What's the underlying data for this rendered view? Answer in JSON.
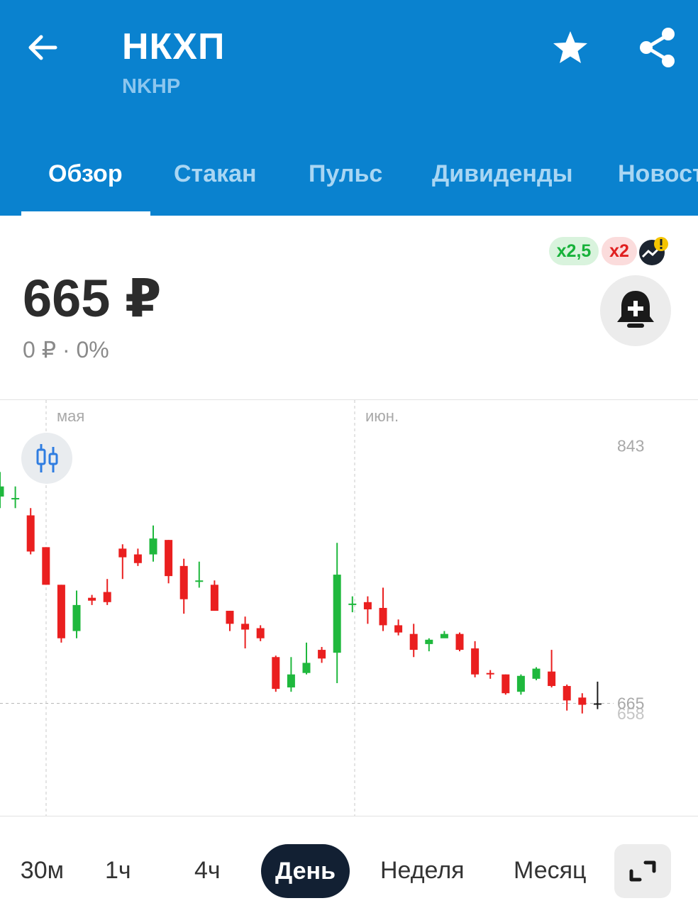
{
  "header": {
    "title": "НКХП",
    "ticker": "NKHP",
    "icons": {
      "back": "arrow-left-icon",
      "favorite": "star-icon",
      "share": "share-icon"
    }
  },
  "tabs": [
    {
      "label": "Обзор",
      "active": true
    },
    {
      "label": "Стакан"
    },
    {
      "label": "Пульс"
    },
    {
      "label": "Дивиденды"
    },
    {
      "label": "Новост"
    }
  ],
  "quote": {
    "price": "665 ₽",
    "change": "0 ₽ · 0%",
    "badge_long": "x2,5",
    "badge_short": "x2"
  },
  "colors": {
    "brand": "#0a82cf",
    "up": "#1fb83d",
    "down": "#ea1f1f",
    "active_pill": "#122033"
  },
  "chart_data": {
    "type": "candlestick",
    "x_labels": [
      "мая",
      "июн."
    ],
    "y_labels": [
      "843",
      "665",
      "658"
    ],
    "last_price": 665,
    "ylim": [
      600,
      860
    ],
    "candles": [
      {
        "o": 808,
        "h": 825,
        "c": 815,
        "l": 800
      },
      {
        "o": 807,
        "h": 815,
        "c": 807,
        "l": 800
      },
      {
        "o": 795,
        "h": 800,
        "c": 770,
        "l": 768
      },
      {
        "o": 773,
        "h": 773,
        "c": 747,
        "l": 747
      },
      {
        "o": 747,
        "h": 747,
        "c": 710,
        "l": 707
      },
      {
        "o": 715,
        "h": 743,
        "c": 733,
        "l": 710
      },
      {
        "o": 738,
        "h": 740,
        "c": 736,
        "l": 733
      },
      {
        "o": 742,
        "h": 751,
        "c": 735,
        "l": 733
      },
      {
        "o": 772,
        "h": 775,
        "c": 766,
        "l": 751
      },
      {
        "o": 768,
        "h": 772,
        "c": 762,
        "l": 760
      },
      {
        "o": 768,
        "h": 788,
        "c": 779,
        "l": 763
      },
      {
        "o": 778,
        "h": 778,
        "c": 753,
        "l": 748
      },
      {
        "o": 760,
        "h": 765,
        "c": 737,
        "l": 727
      },
      {
        "o": 749,
        "h": 763,
        "c": 750,
        "l": 745
      },
      {
        "o": 747,
        "h": 750,
        "c": 729,
        "l": 729
      },
      {
        "o": 729,
        "h": 729,
        "c": 720,
        "l": 715
      },
      {
        "o": 720,
        "h": 725,
        "c": 716,
        "l": 703
      },
      {
        "o": 717,
        "h": 719,
        "c": 710,
        "l": 708
      },
      {
        "o": 697,
        "h": 698,
        "c": 675,
        "l": 673
      },
      {
        "o": 676,
        "h": 697,
        "c": 685,
        "l": 673
      },
      {
        "o": 686,
        "h": 707,
        "c": 693,
        "l": 685
      },
      {
        "o": 702,
        "h": 704,
        "c": 696,
        "l": 693
      },
      {
        "o": 700,
        "h": 776,
        "c": 754,
        "l": 679
      },
      {
        "o": 733,
        "h": 739,
        "c": 734,
        "l": 728
      },
      {
        "o": 735,
        "h": 739,
        "c": 730,
        "l": 720
      },
      {
        "o": 731,
        "h": 745,
        "c": 719,
        "l": 715
      },
      {
        "o": 719,
        "h": 723,
        "c": 714,
        "l": 712
      },
      {
        "o": 713,
        "h": 720,
        "c": 702,
        "l": 697
      },
      {
        "o": 706,
        "h": 710,
        "c": 709,
        "l": 701
      },
      {
        "o": 710,
        "h": 715,
        "c": 713,
        "l": 712
      },
      {
        "o": 713,
        "h": 714,
        "c": 702,
        "l": 701
      },
      {
        "o": 703,
        "h": 708,
        "c": 685,
        "l": 683
      },
      {
        "o": 686,
        "h": 688,
        "c": 685,
        "l": 682
      },
      {
        "o": 685,
        "h": 685,
        "c": 672,
        "l": 671
      },
      {
        "o": 673,
        "h": 685,
        "c": 684,
        "l": 671
      },
      {
        "o": 682,
        "h": 690,
        "c": 689,
        "l": 681
      },
      {
        "o": 687,
        "h": 702,
        "c": 677,
        "l": 676
      },
      {
        "o": 677,
        "h": 678,
        "c": 667,
        "l": 660
      },
      {
        "o": 669,
        "h": 672,
        "c": 664,
        "l": 658
      },
      {
        "o": 665,
        "h": 680,
        "c": 665,
        "l": 661
      }
    ]
  },
  "periods": [
    {
      "label": "30м"
    },
    {
      "label": "1ч"
    },
    {
      "label": "4ч"
    },
    {
      "label": "День",
      "active": true
    },
    {
      "label": "Неделя"
    },
    {
      "label": "Месяц"
    }
  ]
}
